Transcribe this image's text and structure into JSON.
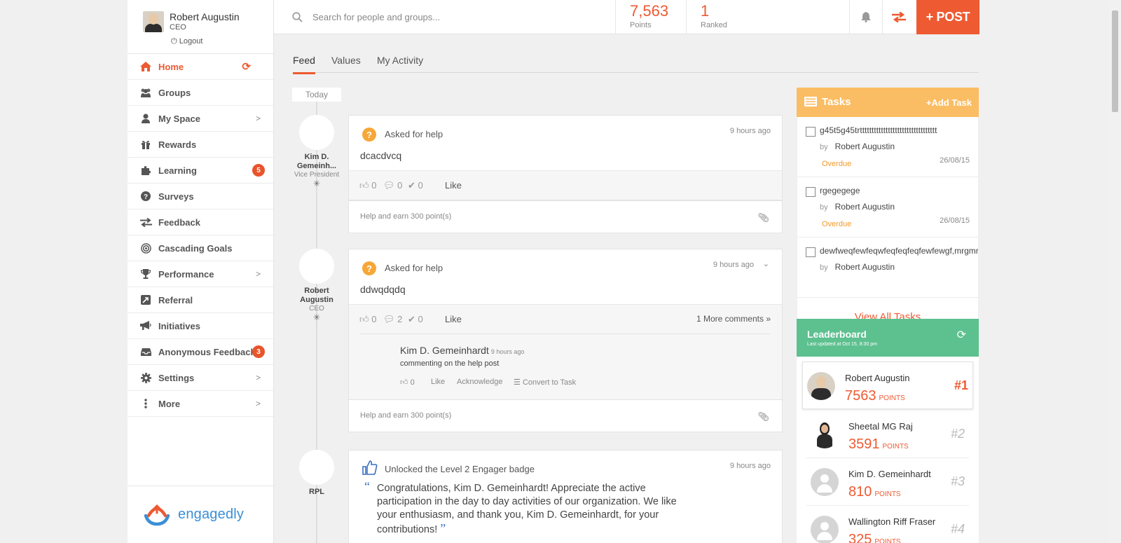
{
  "profile": {
    "name": "Robert Augustin",
    "role": "CEO",
    "logout": "Logout"
  },
  "nav": [
    {
      "label": "Home",
      "icon": "home-icon",
      "active": true
    },
    {
      "label": "Groups",
      "icon": "groups-icon"
    },
    {
      "label": "My Space",
      "icon": "user-icon"
    },
    {
      "label": "Rewards",
      "icon": "gift-icon"
    },
    {
      "label": "Learning",
      "icon": "puzzle-icon",
      "badge": "5"
    },
    {
      "label": "Surveys",
      "icon": "question-icon"
    },
    {
      "label": "Feedback",
      "icon": "exchange-icon"
    },
    {
      "label": "Cascading Goals",
      "icon": "target-icon"
    },
    {
      "label": "Performance",
      "icon": "trophy-icon"
    },
    {
      "label": "Referral",
      "icon": "referral-icon"
    },
    {
      "label": "Initiatives",
      "icon": "megaphone-icon"
    },
    {
      "label": "Anonymous Feedback",
      "icon": "inbox-icon",
      "badge": "3"
    },
    {
      "label": "Settings",
      "icon": "gear-icon"
    },
    {
      "label": "More",
      "icon": "more-icon"
    }
  ],
  "brand": "engagedly",
  "search": {
    "placeholder": "Search for people and groups..."
  },
  "stats": {
    "points": "7,563",
    "points_label": "Points",
    "ranked": "1",
    "ranked_label": "Ranked"
  },
  "post_button": "+ POST",
  "tabs": [
    "Feed",
    "Values",
    "My Activity"
  ],
  "today_label": "Today",
  "posts": [
    {
      "poster_name": "Kim D. Gemeinh...",
      "poster_role": "Vice President",
      "type": "Asked for help",
      "time": "9 hours ago",
      "body": "dcacdvcq",
      "likes": "0",
      "comments": "0",
      "acks": "0",
      "like_label": "Like",
      "footer": "Help and earn 300 point(s)"
    },
    {
      "poster_name": "Robert Augustin",
      "poster_role": "CEO",
      "type": "Asked for help",
      "time": "9 hours ago",
      "body": "ddwqdqdq",
      "likes": "0",
      "comments": "2",
      "acks": "0",
      "like_label": "Like",
      "more_comments": "1 More comments",
      "comment": {
        "author": "Kim D. Gemeinhardt",
        "time": "9 hours ago",
        "text": "commenting on the help post",
        "likes": "0",
        "like": "Like",
        "acknowledge": "Acknowledge",
        "convert": "Convert to Task"
      },
      "footer": "Help and earn 300 point(s)"
    },
    {
      "poster_name": "RPL",
      "type": "Unlocked the Level 2 Engager badge",
      "time": "9 hours ago",
      "body": "Congratulations, Kim D.  Gemeinhardt! Appreciate the active participation in the day to day activities of our organization. We like your enthusiasm, and thank you, Kim D.  Gemeinhardt, for your contributions!"
    }
  ],
  "tasks": {
    "title": "Tasks",
    "add": "+Add Task",
    "view_all": "View All Tasks",
    "items": [
      {
        "text": "g45t5g45trttttttttttttttttttttttttttttttttt",
        "by": "by",
        "owner": "Robert Augustin",
        "status": "Overdue",
        "due": "26/08/15"
      },
      {
        "text": "rgegegege",
        "by": "by",
        "owner": "Robert Augustin",
        "status": "Overdue",
        "due": "26/08/15"
      },
      {
        "text": "dewfweqfewfeqwfeqfeqfeqfewfewgf,mrgmrg",
        "by": "by",
        "owner": "Robert Augustin",
        "status": "",
        "due": ""
      }
    ]
  },
  "leaderboard": {
    "title": "Leaderboard",
    "updated": "Last updated at Oct 15, 8:30 pm",
    "unit": "POINTS",
    "rows": [
      {
        "name": "Robert Augustin",
        "points": "7563",
        "rank": "#1"
      },
      {
        "name": "Sheetal MG Raj",
        "points": "3591",
        "rank": "#2"
      },
      {
        "name": "Kim D. Gemeinhardt",
        "points": "810",
        "rank": "#3"
      },
      {
        "name": "Wallington Riff Fraser",
        "points": "325",
        "rank": "#4"
      }
    ]
  },
  "colors": {
    "accent": "#ee5a32",
    "tasks_header": "#fbbd63",
    "leaderboard_header": "#5dc08f",
    "overdue": "#f39a26"
  }
}
